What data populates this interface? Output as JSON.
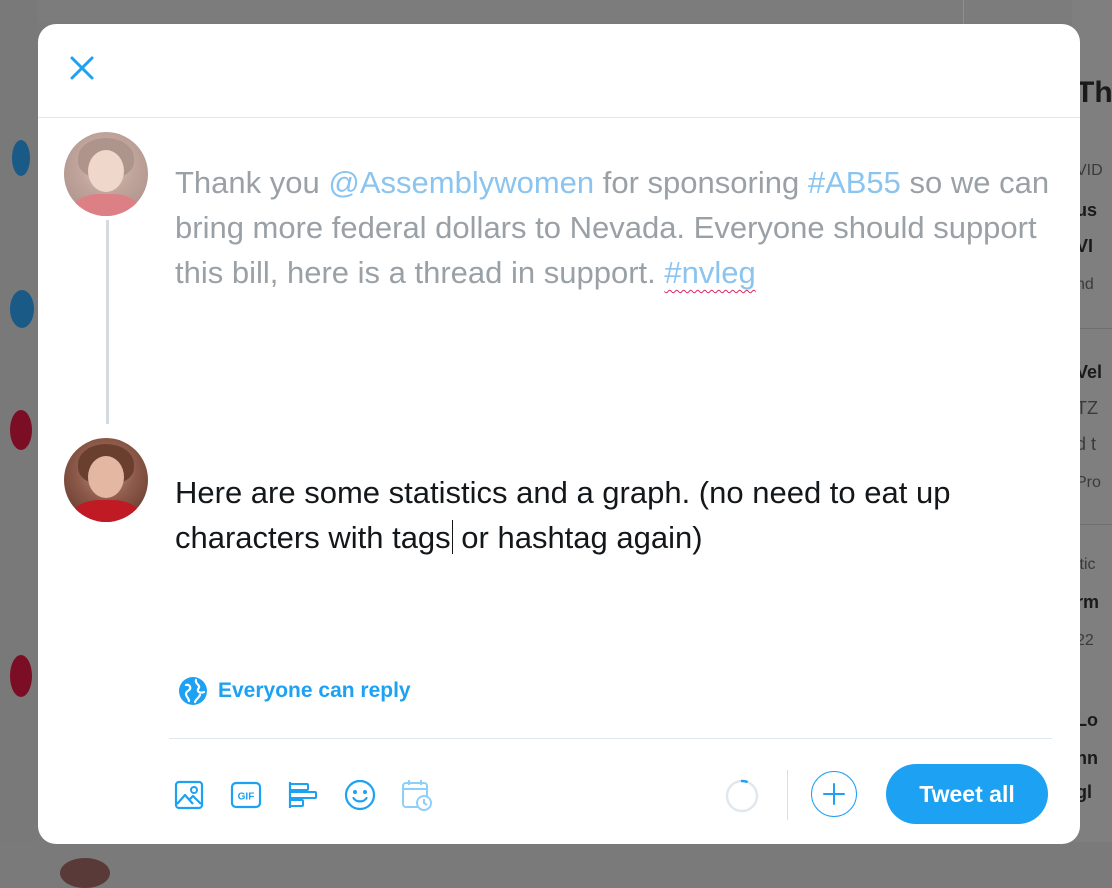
{
  "modal": {
    "close_label": "close",
    "tweets": [
      {
        "parts": {
          "p1": "Thank you ",
          "mention": "@Assemblywomen",
          "p2": " for sponsoring ",
          "hashtag1": "#AB55",
          "p3": " so we can bring more federal dollars to Nevada. Everyone should support this bill, here is a thread in support. ",
          "hashtag2": "#nvleg"
        }
      },
      {
        "before_caret": "Here are some statistics and a graph. (no need to eat up characters with tags",
        "after_caret": " or hashtag again)"
      }
    ],
    "reply_setting": "Everyone can reply",
    "actions": {
      "media_icon": "image-icon",
      "gif_label": "GIF",
      "poll_icon": "poll-icon",
      "emoji_icon": "emoji-icon",
      "schedule_icon": "schedule-icon"
    },
    "char_progress": 0.05,
    "tweet_all_label": "Tweet all",
    "accent_color": "#1da1f2"
  },
  "background_sidebar": {
    "lines": [
      "Tha",
      "VID",
      "us",
      "VI",
      "nd",
      "Vel",
      "TZ",
      "d t",
      "Pro",
      "itic",
      "rm",
      "22",
      "Lo",
      "nn",
      "gl"
    ]
  }
}
